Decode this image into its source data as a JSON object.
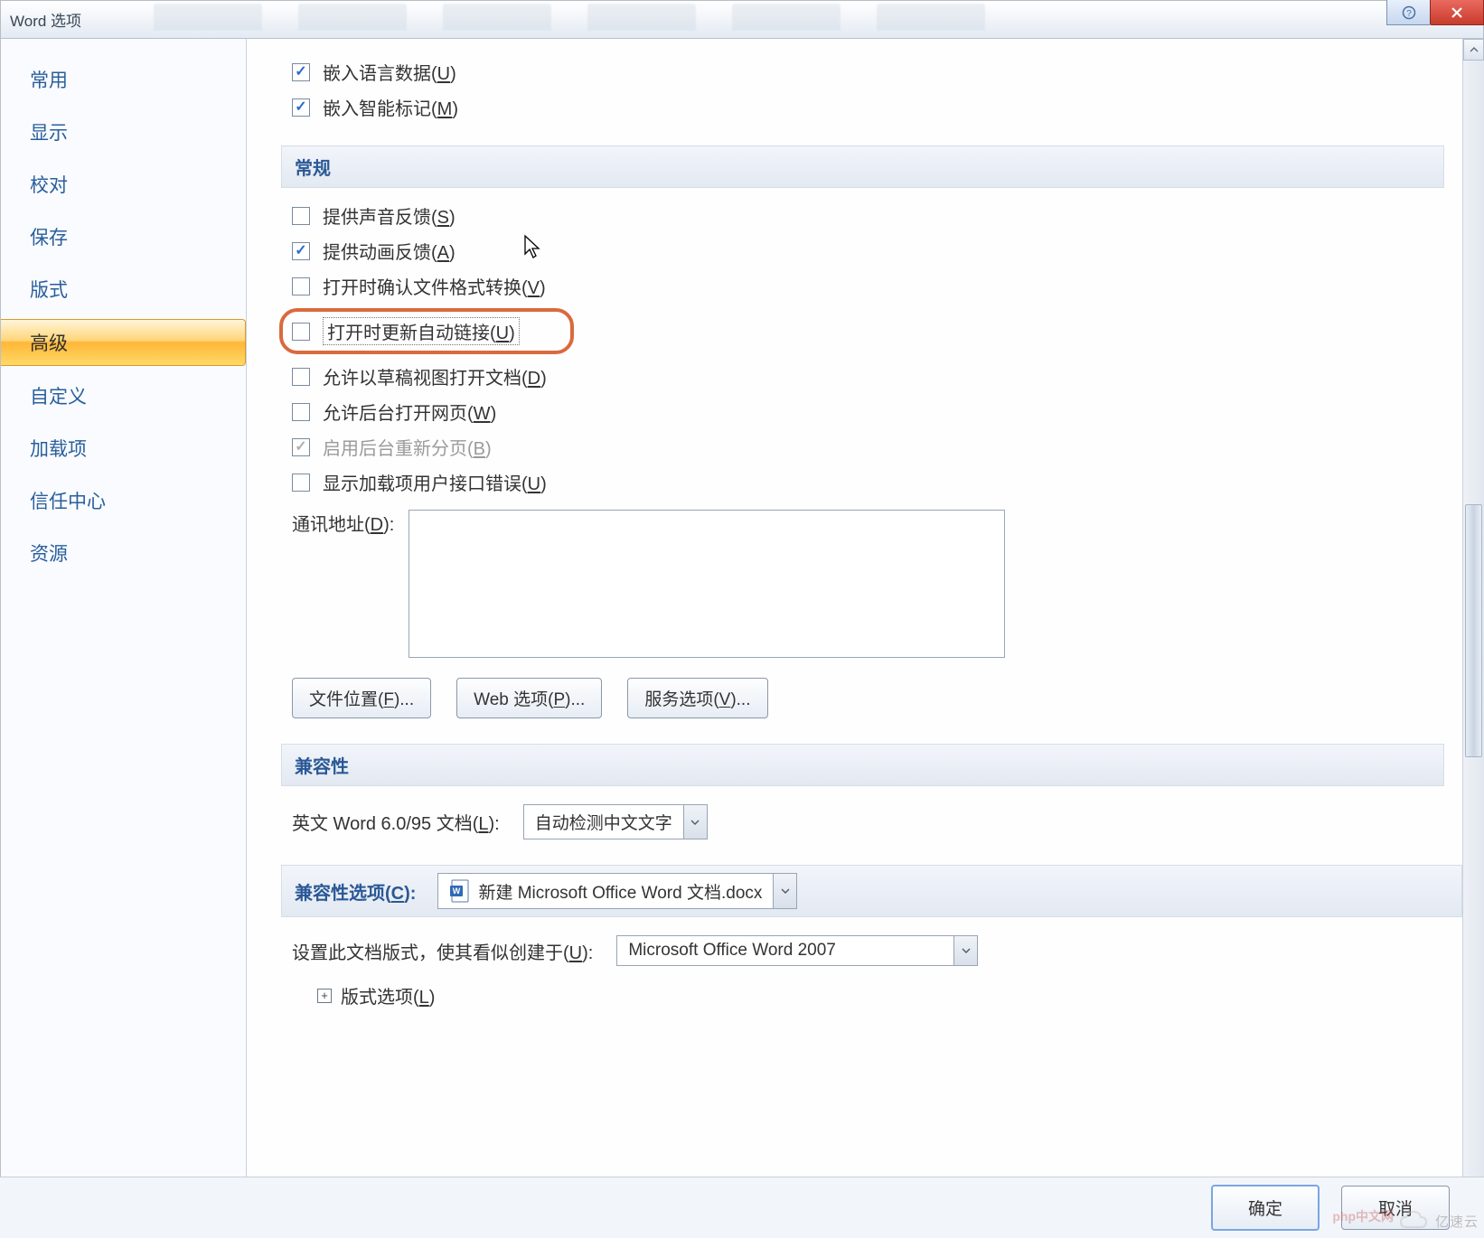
{
  "window": {
    "title": "Word 选项"
  },
  "sidebar": {
    "items": [
      {
        "label": "常用"
      },
      {
        "label": "显示"
      },
      {
        "label": "校对"
      },
      {
        "label": "保存"
      },
      {
        "label": "版式"
      },
      {
        "label": "高级"
      },
      {
        "label": "自定义"
      },
      {
        "label": "加载项"
      },
      {
        "label": "信任中心"
      },
      {
        "label": "资源"
      }
    ]
  },
  "top_checks": {
    "embed_lang_label": "嵌入语言数据(",
    "embed_lang_accel": "U",
    "embed_smart_label": "嵌入智能标记(",
    "embed_smart_accel": "M"
  },
  "section_general": "常规",
  "general": {
    "sound_label": "提供声音反馈(",
    "sound_accel": "S",
    "anim_label": "提供动画反馈(",
    "anim_accel": "A",
    "confirm_convert_label": "打开时确认文件格式转换(",
    "confirm_convert_accel": "V",
    "update_links_label": "打开时更新自动链接(",
    "update_links_accel": "U",
    "draft_open_label": "允许以草稿视图打开文档(",
    "draft_open_accel": "D",
    "bg_open_label": "允许后台打开网页(",
    "bg_open_accel": "W",
    "bg_repage_label": "启用后台重新分页(",
    "bg_repage_accel": "B",
    "addin_err_label": "显示加载项用户接口错误(",
    "addin_err_accel": "U",
    "mailing_label": "通讯地址(",
    "mailing_accel": "D",
    "mailing_suffix": "):",
    "mailing_value": ""
  },
  "buttons": {
    "file_locations": "文件位置(",
    "file_locations_accel": "F",
    "web_options": "Web 选项(",
    "web_options_accel": "P",
    "service_options": "服务选项(",
    "service_options_accel": "V",
    "ellipsis": ")..."
  },
  "section_compat": "兼容性",
  "compat": {
    "en_word_label": "英文 Word 6.0/95 文档(",
    "en_word_accel": "L",
    "en_word_suffix": "):",
    "en_word_value": "自动检测中文文字",
    "compat_opts_label": "兼容性选项(",
    "compat_opts_accel": "C",
    "compat_opts_suffix": "):",
    "compat_opts_value": "新建 Microsoft Office Word 文档.docx",
    "layout_label": "设置此文档版式，使其看似创建于(",
    "layout_accel": "U",
    "layout_suffix": "):",
    "layout_value": "Microsoft Office Word 2007",
    "layout_options": "版式选项(",
    "layout_options_accel": "L"
  },
  "footer": {
    "ok": "确定",
    "cancel": "取消"
  },
  "watermark": {
    "php": "php中文网",
    "ysy": "亿速云"
  },
  "paren_close": ")"
}
